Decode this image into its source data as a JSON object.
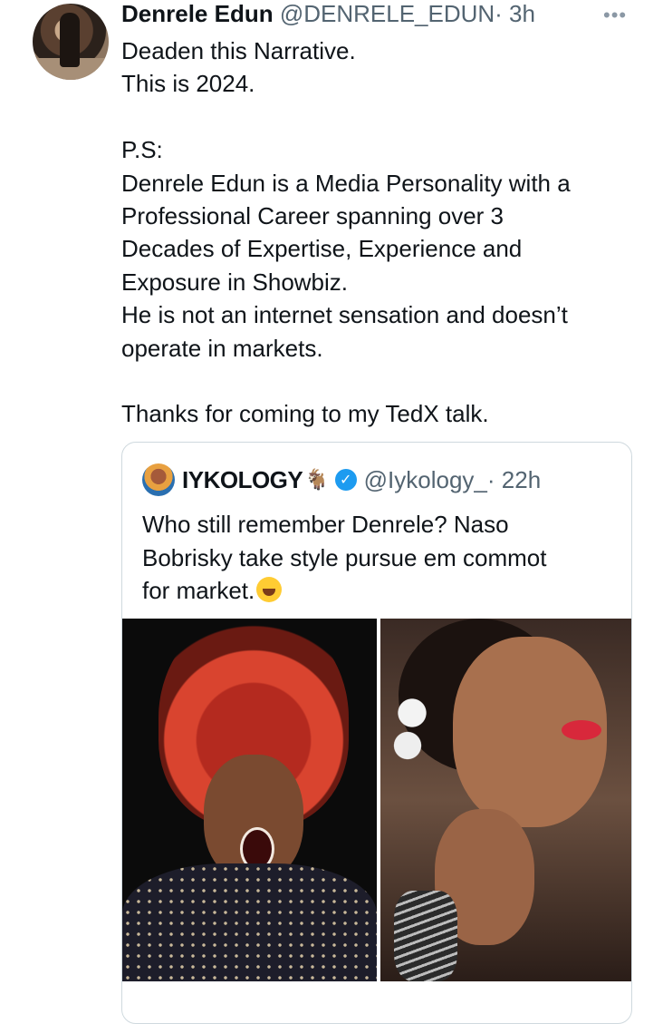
{
  "tweet": {
    "author_name": "Denrele Edun",
    "author_handle": "@DENRELE_EDUN",
    "time": "· 3h",
    "more": "•••",
    "lines": {
      "l1": "Deaden this Narrative.",
      "l2": "This is 2024.",
      "l3": "P.S:",
      "l4": "Denrele Edun is a Media Personality with a",
      "l5": "Professional Career spanning over 3",
      "l6": "Decades of Expertise, Experience and",
      "l7": "Exposure in Showbiz.",
      "l8": "He is not an internet sensation and doesn’t",
      "l9": "operate in markets.",
      "l10": "Thanks for coming to my TedX talk."
    }
  },
  "quoted_tweet": {
    "author_name": "IYKOLOGY",
    "name_emoji": "🐐",
    "verified_icon": "✓",
    "author_handle": "@Iykology_",
    "time": "· 22h",
    "lines": {
      "l1": "Who still remember Denrele? Naso",
      "l2": "Bobrisky take style pursue em commot",
      "l3": "for market."
    },
    "emoji": "rolling-on-floor-laughing-icon"
  }
}
